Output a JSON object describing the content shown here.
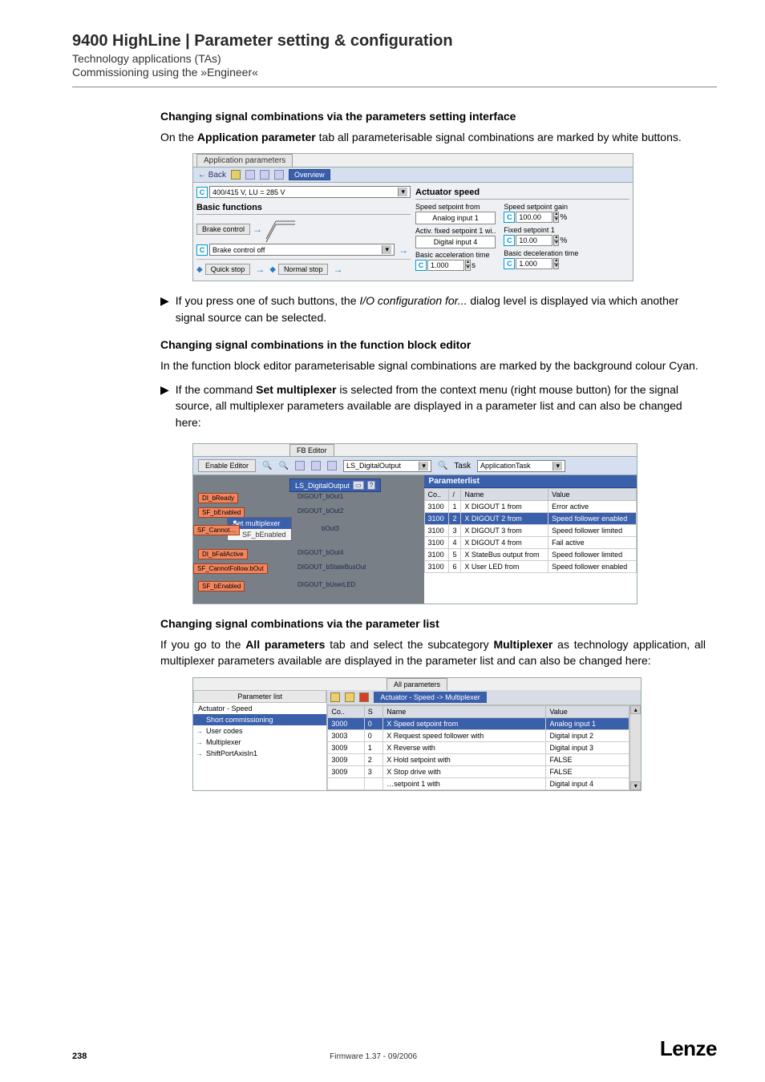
{
  "header": {
    "title": "9400 HighLine | Parameter setting & configuration",
    "sub1": "Technology applications (TAs)",
    "sub2": "Commissioning using the »Engineer«"
  },
  "sec1": {
    "head": "Changing signal combinations via the parameters setting interface",
    "para_pre": "On the ",
    "para_bold": "Application parameter",
    "para_post": " tab all parameterisable signal combinations are marked by white buttons.",
    "bullet_pre": "If you press one of such buttons, the ",
    "bullet_italic": "I/O configuration for...",
    "bullet_post": " dialog level is displayed via which another signal source can be selected."
  },
  "shot1": {
    "tab": "Application parameters",
    "back": "← Back",
    "overview": "Overview",
    "voltage": "400/415 V, LU = 285 V",
    "actuator": "Actuator speed",
    "basic": "Basic functions",
    "brake": "Brake control",
    "brakeoff": "Brake control off",
    "quick": "Quick stop",
    "normal": "Normal stop",
    "spd_from": "Speed setpoint from",
    "analog1": "Analog input 1",
    "activ": "Activ. fixed setpoint 1 wi..",
    "digital4": "Digital input 4",
    "basic_acc": "Basic acceleration time",
    "gain": "Speed setpoint gain",
    "gainval": "100.00",
    "pct": "%",
    "fixed1": "Fixed setpoint 1",
    "fixed1val": "10.00",
    "decel": "Basic deceleration time",
    "decelval": "1.000",
    "accval": "1.000",
    "s": "s"
  },
  "sec2": {
    "head": "Changing signal combinations in the function block editor",
    "para": "In the function block editor parameterisable signal combinations are marked by the background colour Cyan.",
    "bullet_pre": "If the command ",
    "bullet_bold": "Set multiplexer",
    "bullet_post": " is selected from the context menu (right mouse button) for the signal source, all multiplexer parameters available are displayed in a parameter list and can also be changed here:"
  },
  "shot2": {
    "tab": "FB Editor",
    "enable": "Enable Editor",
    "combo": "LS_DigitalOutput",
    "task_lbl": "Task",
    "task": "ApplicationTask",
    "listhead": "Parameterlist",
    "node_title": "LS_DigitalOutput",
    "ports": [
      "DIGOUT_bOut1",
      "DIGOUT_bOut2",
      "bOut3",
      "DIGOUT_bOut4",
      "DIGOUT_bStateBusOut",
      "DIGOUT_bUserLED"
    ],
    "sigs": [
      "DI_bReady",
      "SF_bEnabled",
      "SF_Cannot…",
      "DI_bFailActive",
      "SF_CannotFollow.bOut",
      "SF_bEnabled"
    ],
    "ctx_sel": "Set multiplexer",
    "ctx_item": "SF_bEnabled",
    "th": [
      "Co..",
      "/",
      "Name",
      "Value"
    ],
    "rows": [
      {
        "c": "3100",
        "s": "1",
        "n": "X DIGOUT 1 from",
        "v": "Error active"
      },
      {
        "c": "3100",
        "s": "2",
        "n": "X DIGOUT 2 from",
        "v": "Speed follower enabled"
      },
      {
        "c": "3100",
        "s": "3",
        "n": "X DIGOUT 3 from",
        "v": "Speed follower limited"
      },
      {
        "c": "3100",
        "s": "4",
        "n": "X DIGOUT 4 from",
        "v": "Fail active"
      },
      {
        "c": "3100",
        "s": "5",
        "n": "X StateBus output from",
        "v": "Speed follower limited"
      },
      {
        "c": "3100",
        "s": "6",
        "n": "X User LED from",
        "v": "Speed follower enabled"
      }
    ]
  },
  "sec3": {
    "head": "Changing signal combinations via the parameter list",
    "para_pre": "If you go to the ",
    "para_b1": "All parameters",
    "para_mid": " tab and select the subcategory ",
    "para_b2": "Multiplexer",
    "para_post": " as technology application, all multiplexer parameters available are displayed in the parameter list and can also be changed here:"
  },
  "shot3": {
    "tab": "All parameters",
    "lhead": "Parameter list",
    "tree": [
      "Actuator - Speed",
      "Short commissioning",
      "User codes",
      "Multiplexer",
      "ShiftPortAxisIn1"
    ],
    "crumb": "Actuator - Speed -> Multiplexer",
    "th": [
      "Co..",
      "S",
      "Name",
      "Value"
    ],
    "rows": [
      {
        "c": "3000",
        "s": "0",
        "n": "X Speed setpoint from",
        "v": "Analog input 1"
      },
      {
        "c": "3003",
        "s": "0",
        "n": "X Request speed follower with",
        "v": "Digital input 2"
      },
      {
        "c": "3009",
        "s": "1",
        "n": "X Reverse with",
        "v": "Digital input 3"
      },
      {
        "c": "3009",
        "s": "2",
        "n": "X Hold setpoint with",
        "v": "FALSE"
      },
      {
        "c": "3009",
        "s": "3",
        "n": "X Stop drive with",
        "v": "FALSE"
      },
      {
        "c": "",
        "s": "",
        "n": "…setpoint 1 with",
        "v": "Digital input 4"
      }
    ]
  },
  "footer": {
    "page": "238",
    "fw": "Firmware 1.37 - 09/2006",
    "brand": "Lenze"
  }
}
